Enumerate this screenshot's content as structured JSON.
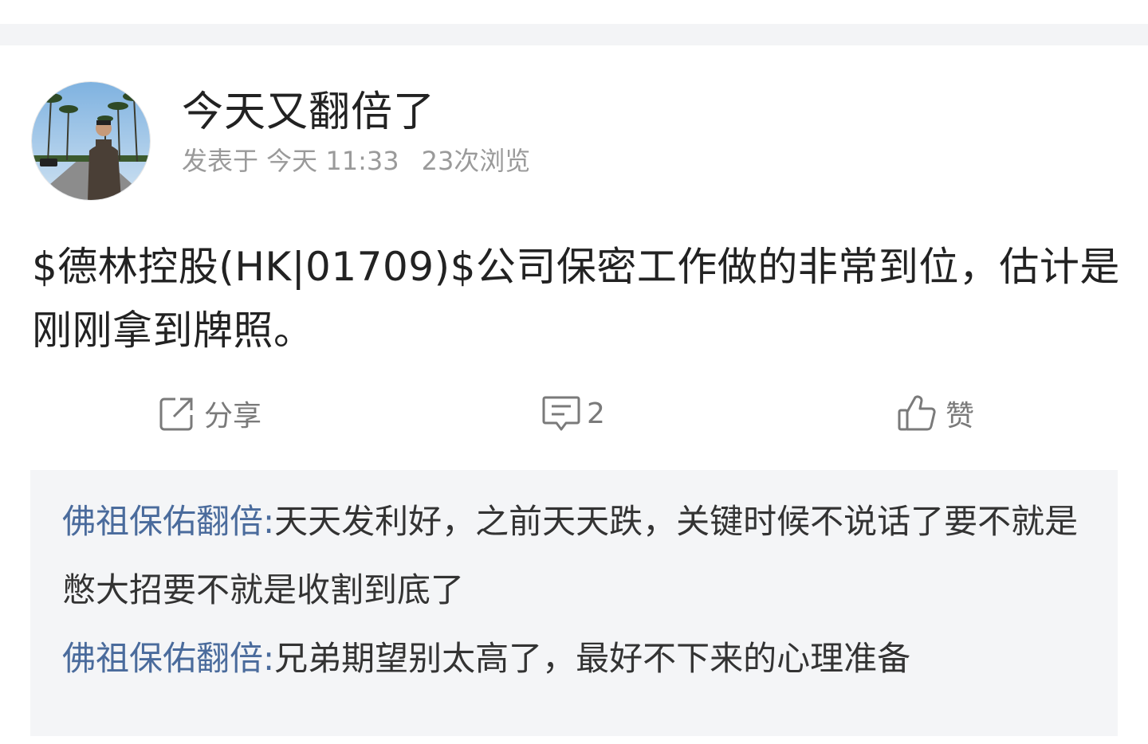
{
  "post": {
    "author": "今天又翻倍了",
    "meta": {
      "published": "发表于 今天 11:33",
      "views": "23次浏览"
    },
    "content": "$德林控股(HK|01709)$公司保密工作做的非常到位，估计是刚刚拿到牌照。"
  },
  "actions": {
    "share": {
      "icon": "share-icon",
      "label": "分享"
    },
    "comment": {
      "icon": "comment-icon",
      "label": "2"
    },
    "like": {
      "icon": "thumbs-up-icon",
      "label": "赞"
    }
  },
  "comments": [
    {
      "user": "佛祖保佑翻倍",
      "separator": ":",
      "text": "天天发利好，之前天天跌，关键时候不说话了要不就是憋大招要不就是收割到底了"
    },
    {
      "user": "佛祖保佑翻倍",
      "separator": ":",
      "text": "兄弟期望别太高了，最好不下来的心理准备"
    }
  ],
  "colors": {
    "username_link": "#4a6b9c",
    "meta_gray": "#9a9a9a",
    "comment_bg": "#f4f5f7"
  }
}
